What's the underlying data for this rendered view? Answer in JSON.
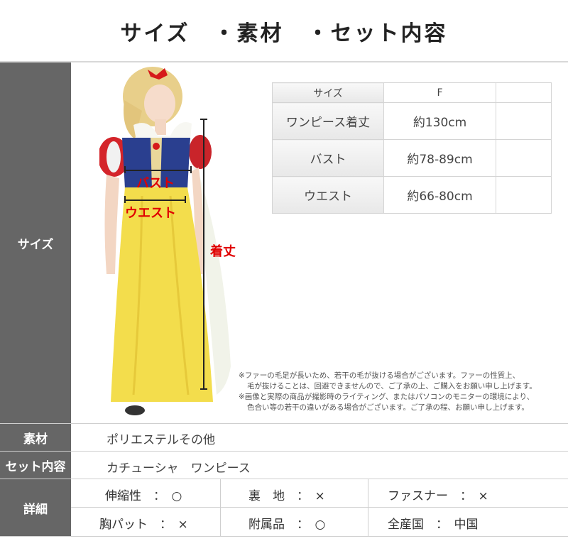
{
  "title": "サイズ　・素材　・セット内容",
  "rows": {
    "size_label": "サイズ",
    "material_label": "素材",
    "material_value": "ポリエステルその他",
    "set_label": "セット内容",
    "set_value": "カチューシャ　ワンピース",
    "detail_label": "詳細"
  },
  "figure": {
    "bust_label": "バスト",
    "waist_label": "ウエスト",
    "length_label": "着丈"
  },
  "size_table": {
    "header": [
      "サイズ",
      "F",
      ""
    ],
    "rows": [
      [
        "ワンピース着丈",
        "約130cm",
        ""
      ],
      [
        "バスト",
        "約78-89cm",
        ""
      ],
      [
        "ウエスト",
        "約66-80cm",
        ""
      ]
    ]
  },
  "notes": [
    "※ファーの毛足が長いため、若干の毛が抜ける場合がございます。ファーの性質上、",
    "毛が抜けることは、回避できませんので、ご了承の上、ご購入をお願い申し上げます。",
    "※画像と実際の商品が撮影時のライティング、またはパソコンのモニターの環境により、",
    "色合い等の若干の違いがある場合がございます。ご了承の程、お願い申し上げます。"
  ],
  "details": [
    [
      "伸縮性　：　○",
      "裏　地　：　×",
      "ファスナー　：　×"
    ],
    [
      "胸パット　：　×",
      "附属品　：　○",
      "全産国　：　中国"
    ]
  ],
  "colors": {
    "sidebar": "#666666",
    "annotation_red": "#e00000",
    "dress_yellow": "#f3dd4c",
    "bodice_blue": "#2a3f8f"
  }
}
